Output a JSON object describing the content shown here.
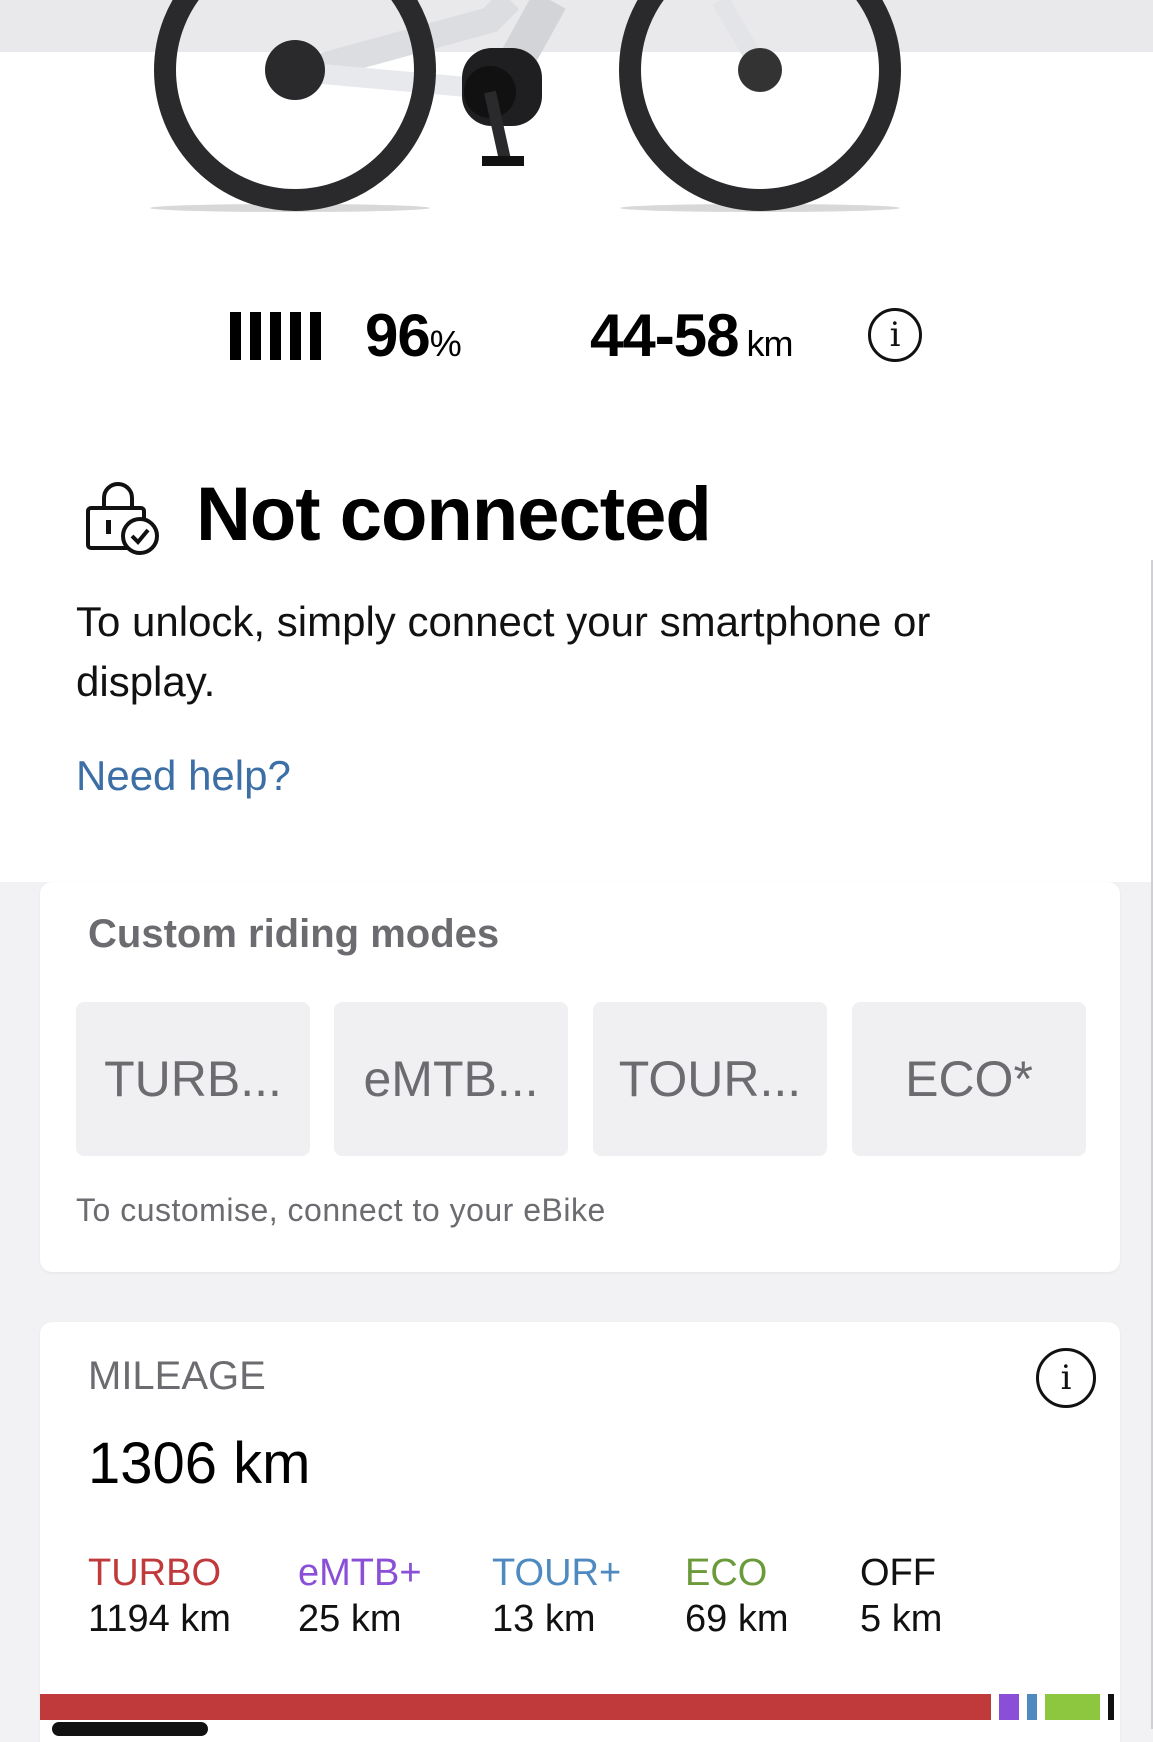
{
  "stats": {
    "battery_value": "96",
    "battery_unit": "%",
    "battery_level": 0.96,
    "range_value": "44-58",
    "range_unit": "km",
    "info_glyph": "i"
  },
  "status": {
    "icon": "lock-check-icon",
    "title": "Not connected",
    "description": "To unlock, simply connect your smartphone or display.",
    "help_link": "Need help?"
  },
  "riding_modes": {
    "title": "Custom riding modes",
    "modes": [
      "TURB...",
      "eMTB...",
      "TOUR...",
      "ECO*"
    ],
    "hint": "To customise, connect to your eBike"
  },
  "mileage": {
    "label": "MILEAGE",
    "info_glyph": "i",
    "total": "1306 km",
    "modes": [
      {
        "name": "TURBO",
        "value": "1194 km",
        "color": "#c0393b",
        "km": 1194
      },
      {
        "name": "eMTB+",
        "value": "25 km",
        "color": "#8a4fd6",
        "km": 25
      },
      {
        "name": "TOUR+",
        "value": "13 km",
        "color": "#4e8abf",
        "km": 13
      },
      {
        "name": "ECO",
        "value": "69 km",
        "color": "#6a9a3a",
        "km": 69
      },
      {
        "name": "OFF",
        "value": "5 km",
        "color": "#111111",
        "km": 5
      }
    ]
  },
  "colors": {
    "link": "#3c6fa6",
    "muted_text": "#6b6b70",
    "background": "#f2f2f4",
    "bar_eco": "#8dc63f"
  }
}
